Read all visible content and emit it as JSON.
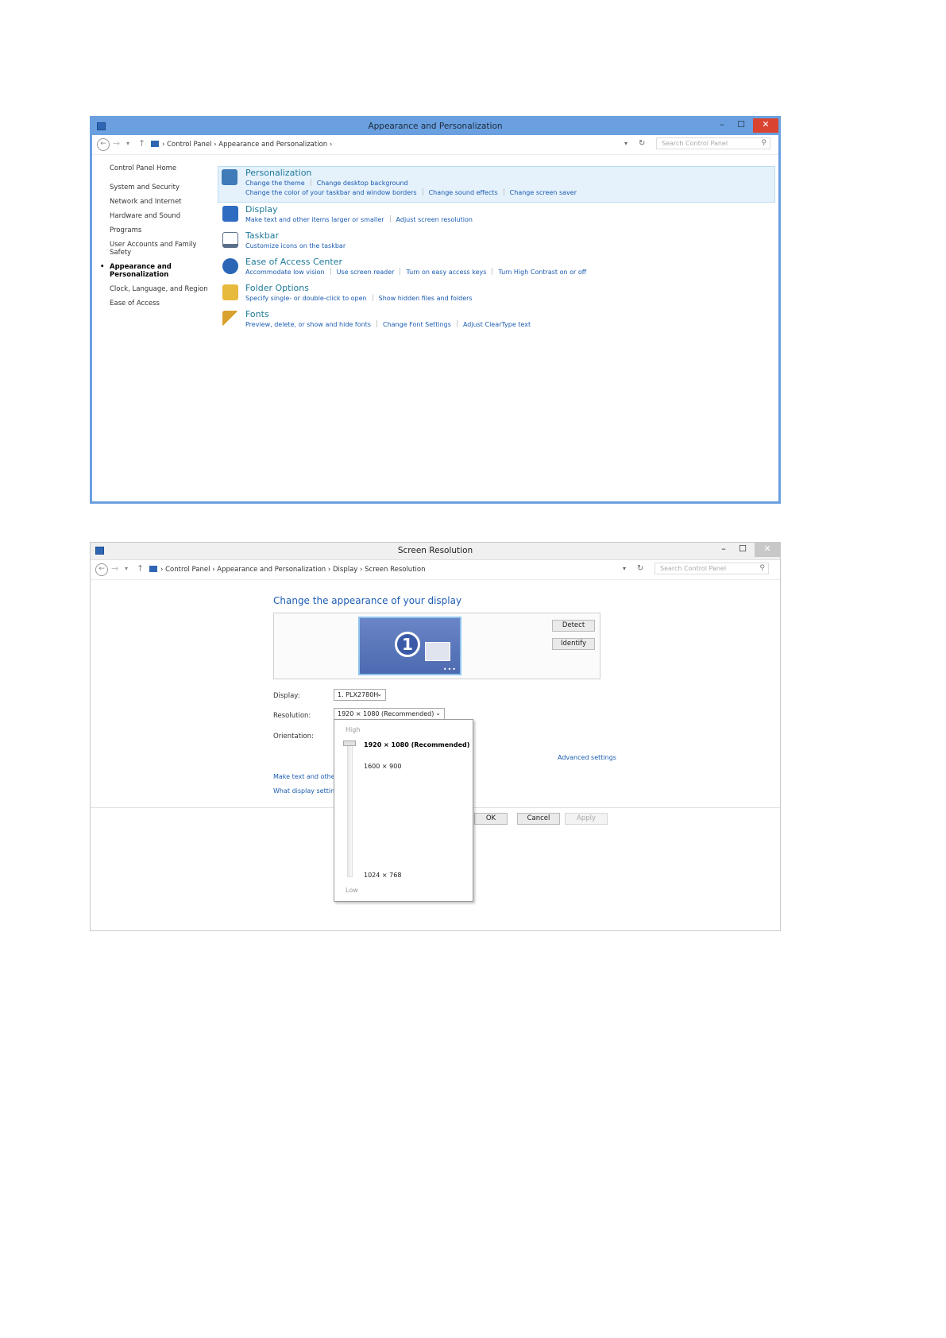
{
  "window1": {
    "title": "Appearance and Personalization",
    "controls": {
      "minimize": "–",
      "maximize": "☐",
      "close": "✕"
    },
    "breadcrumb": [
      "Control Panel",
      "Appearance and Personalization"
    ],
    "search_placeholder": "Search Control Panel",
    "sidebar": [
      "Control Panel Home",
      "System and Security",
      "Network and Internet",
      "Hardware and Sound",
      "Programs",
      "User Accounts and Family Safety",
      "Appearance and Personalization",
      "Clock, Language, and Region",
      "Ease of Access"
    ],
    "categories": [
      {
        "title": "Personalization",
        "links_row1": [
          "Change the theme",
          "Change desktop background"
        ],
        "links_row2": [
          "Change the color of your taskbar and window borders",
          "Change sound effects",
          "Change screen saver"
        ]
      },
      {
        "title": "Display",
        "links": [
          "Make text and other items larger or smaller",
          "Adjust screen resolution"
        ]
      },
      {
        "title": "Taskbar",
        "links": [
          "Customize icons on the taskbar"
        ]
      },
      {
        "title": "Ease of Access Center",
        "links": [
          "Accommodate low vision",
          "Use screen reader",
          "Turn on easy access keys",
          "Turn High Contrast on or off"
        ]
      },
      {
        "title": "Folder Options",
        "links": [
          "Specify single- or double-click to open",
          "Show hidden files and folders"
        ]
      },
      {
        "title": "Fonts",
        "links": [
          "Preview, delete, or show and hide fonts",
          "Change Font Settings",
          "Adjust ClearType text"
        ]
      }
    ],
    "icon_colors": [
      "#3f7bb8",
      "#2d6cc0",
      "#5a6f8a",
      "#2a66b5",
      "#e7b93c",
      "#d9a12d"
    ]
  },
  "window2": {
    "title": "Screen Resolution",
    "controls": {
      "minimize": "–",
      "maximize": "☐",
      "close": "✕"
    },
    "breadcrumb": [
      "Control Panel",
      "Appearance and Personalization",
      "Display",
      "Screen Resolution"
    ],
    "search_placeholder": "Search Control Panel",
    "heading": "Change the appearance of your display",
    "monitor_number": "1",
    "buttons": {
      "detect": "Detect",
      "identify": "Identify",
      "ok": "OK",
      "cancel": "Cancel",
      "apply": "Apply"
    },
    "labels": {
      "display": "Display:",
      "resolution": "Resolution:",
      "orientation": "Orientation:"
    },
    "display_value": "1. PLX2780H",
    "resolution_value": "1920 × 1080 (Recommended)",
    "links": {
      "advanced": "Advanced settings",
      "make_text": "Make text and other",
      "what_display": "What display settin"
    },
    "dropdown": {
      "high": "High",
      "low": "Low",
      "options": [
        "1920 × 1080 (Recommended)",
        "1600 × 900",
        "1024 × 768"
      ],
      "selected": "1920 × 1080 (Recommended)"
    }
  }
}
